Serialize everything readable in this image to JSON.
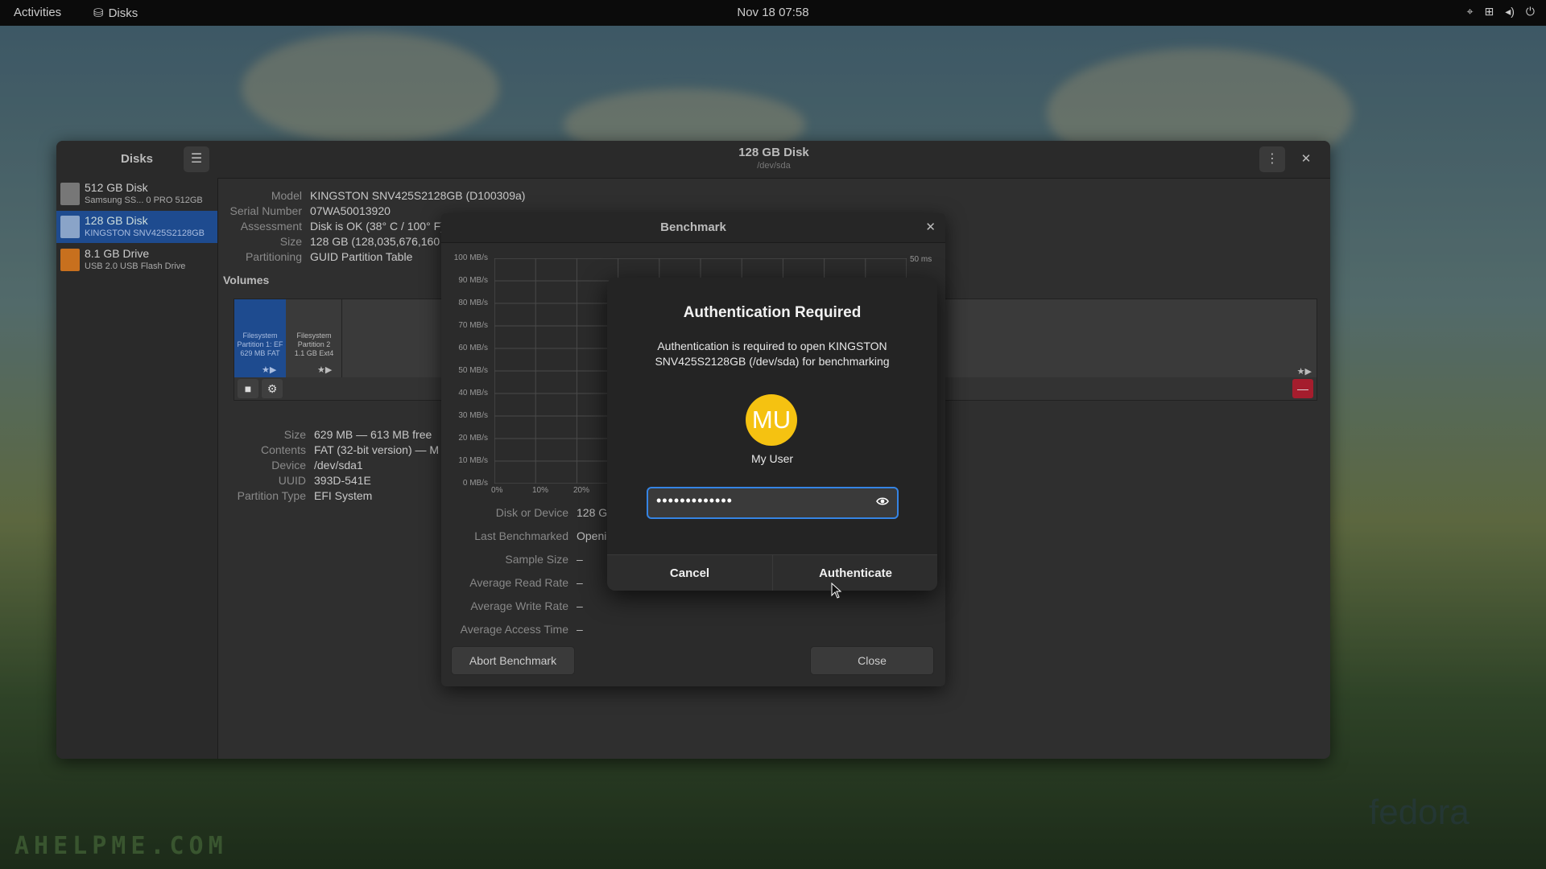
{
  "topbar": {
    "activities": "Activities",
    "app_name": "Disks",
    "clock": "Nov 18  07:58",
    "tray_icons": [
      "location-icon",
      "network-icon",
      "volume-icon",
      "power-icon"
    ]
  },
  "window": {
    "sidebar_title": "Disks",
    "title": "128 GB Disk",
    "subtitle": "/dev/sda",
    "drives": [
      {
        "name": "512 GB Disk",
        "sub": "Samsung SS... 0 PRO 512GB"
      },
      {
        "name": "128 GB Disk",
        "sub": "KINGSTON SNV425S2128GB"
      },
      {
        "name": "8.1 GB Drive",
        "sub": "USB 2.0 USB Flash Drive"
      }
    ],
    "disk_info": [
      {
        "k": "Model",
        "v": "KINGSTON SNV425S2128GB (D100309a)"
      },
      {
        "k": "Serial Number",
        "v": "07WA50013920"
      },
      {
        "k": "Assessment",
        "v": "Disk is OK (38° C / 100° F)"
      },
      {
        "k": "Size",
        "v": "128 GB (128,035,676,160"
      },
      {
        "k": "Partitioning",
        "v": "GUID Partition Table"
      }
    ],
    "volumes_label": "Volumes",
    "partitions": [
      {
        "line1": "Filesystem",
        "line2": "Partition 1: EF",
        "line3": "629 MB FAT"
      },
      {
        "line1": "Filesystem",
        "line2": "Partition 2",
        "line3": "1.1 GB Ext4"
      }
    ],
    "partition_info": [
      {
        "k": "Size",
        "v": "629 MB — 613 MB free"
      },
      {
        "k": "Contents",
        "v": "FAT (32-bit version) — M"
      },
      {
        "k": "Device",
        "v": "/dev/sda1"
      },
      {
        "k": "UUID",
        "v": "393D-541E"
      },
      {
        "k": "Partition Type",
        "v": "EFI System"
      }
    ]
  },
  "benchmark": {
    "title": "Benchmark",
    "y_ticks": [
      "100 MB/s",
      "90 MB/s",
      "80 MB/s",
      "70 MB/s",
      "60 MB/s",
      "50 MB/s",
      "40 MB/s",
      "30 MB/s",
      "20 MB/s",
      "10 MB/s",
      "0 MB/s"
    ],
    "x_ticks": [
      "0%",
      "10%",
      "20%"
    ],
    "right_tick": "50 ms",
    "rows": [
      {
        "k": "Disk or Device",
        "v": "128 GB"
      },
      {
        "k": "Last Benchmarked",
        "v": "Openir"
      },
      {
        "k": "Sample Size",
        "v": "–"
      },
      {
        "k": "Average Read Rate",
        "v": "–"
      },
      {
        "k": "Average Write Rate",
        "v": "–"
      },
      {
        "k": "Average Access Time",
        "v": "–"
      }
    ],
    "abort_label": "Abort Benchmark",
    "close_label": "Close"
  },
  "auth": {
    "title": "Authentication Required",
    "message": "Authentication is required to open KINGSTON SNV425S2128GB (/dev/sda) for benchmarking",
    "avatar_initials": "MU",
    "avatar_color": "#f5c211",
    "user_name": "My User",
    "password_mask": "•••••••••••••",
    "cancel_label": "Cancel",
    "authenticate_label": "Authenticate",
    "focus_color": "#3584e4"
  },
  "wallpaper": {
    "watermark": "AHELPME.COM",
    "logo_text": "fedora"
  }
}
